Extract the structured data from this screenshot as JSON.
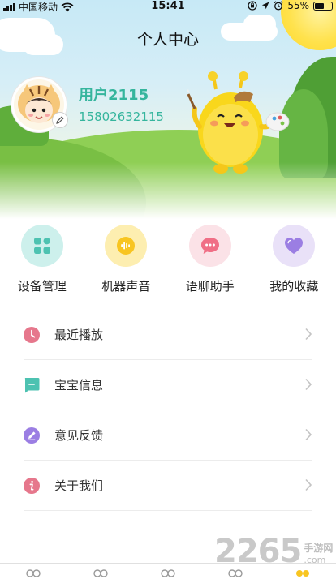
{
  "status_bar": {
    "carrier": "中国移动",
    "time": "15:41",
    "battery": "55%",
    "battery_level": 0.55,
    "icons": [
      "signal-icon",
      "wifi-icon",
      "screen-lock-icon",
      "location-icon",
      "alarm-icon",
      "battery-icon"
    ]
  },
  "header": {
    "title": "个人中心"
  },
  "profile": {
    "username": "用户2115",
    "phone": "15802632115"
  },
  "features": [
    {
      "label": "设备管理",
      "icon": "device-grid-icon",
      "bg": "#cdf0ec",
      "fg": "#4dc2b1"
    },
    {
      "label": "机器声音",
      "icon": "sound-wave-icon",
      "bg": "#fdeeb0",
      "fg": "#f8c521"
    },
    {
      "label": "语聊助手",
      "icon": "chat-bubble-icon",
      "bg": "#fbe2e7",
      "fg": "#f06f86"
    },
    {
      "label": "我的收藏",
      "icon": "heart-icon",
      "bg": "#e9e1f8",
      "fg": "#9b7ee3"
    }
  ],
  "menu": [
    {
      "label": "最近播放",
      "icon": "clock-icon",
      "color": "#e6778c"
    },
    {
      "label": "宝宝信息",
      "icon": "message-icon",
      "color": "#4dc2b1"
    },
    {
      "label": "意见反馈",
      "icon": "pencil-icon",
      "color": "#9b7ee3"
    },
    {
      "label": "关于我们",
      "icon": "info-icon",
      "color": "#e6778c"
    }
  ],
  "tabbar": {
    "active_index": 4,
    "active_color": "#f8c521",
    "inactive_color": "#9a9a9a"
  },
  "watermark": {
    "number": "2265",
    "site_top": "手游网",
    "site_bottom": ".com"
  }
}
